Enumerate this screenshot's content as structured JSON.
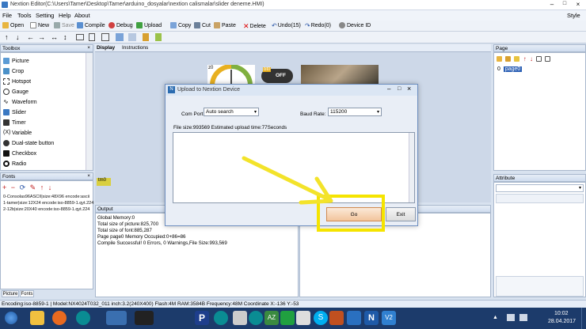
{
  "window": {
    "title": "Nextion Editor(C:\\Users\\Tamer\\Desktop\\Tamer\\arduino_dosyalar\\nextion calismalar\\slider deneme.HMI)"
  },
  "menu": {
    "items": [
      "File",
      "Tools",
      "Setting",
      "Help",
      "About"
    ],
    "style": "Style"
  },
  "toolbar": {
    "open": "Open",
    "new": "New",
    "save": "Save",
    "compile": "Compile",
    "debug": "Debug",
    "upload": "Upload",
    "copy": "Copy",
    "cut": "Cut",
    "paste": "Paste",
    "delete": "Delete",
    "undo": "Undo(15)",
    "redo": "Redo(0)",
    "device_id": "Device  ID"
  },
  "toolbox": {
    "title": "Toolbox",
    "items": [
      "Picture",
      "Crop",
      "Hotspot",
      "Gauge",
      "Waveform",
      "Slider",
      "Timer",
      "Variable",
      "Dual-state button",
      "Checkbox",
      "Radio"
    ]
  },
  "fonts": {
    "title": "Fonts",
    "items": [
      "0-Consolas96ASCII|size:48X96 encode:ascii",
      "1-tamer|size:12X24 encode:iso-8859-1.qyt.224",
      "2-12b|size:20X40 encode:iso-8859-1.qyt.224"
    ]
  },
  "bottom_tabs": {
    "picture": "Picture",
    "fonts": "Fonts"
  },
  "center_tabs": {
    "display": "Display",
    "instructions": "Instructions"
  },
  "canvas": {
    "gauge_label": "z0",
    "toggle_id": "bt0",
    "toggle_state": "OFF",
    "timer_badge": "tm0"
  },
  "page_panel": {
    "title": "Page",
    "item": "page0"
  },
  "attribute_panel": {
    "title": "Attribute"
  },
  "output": {
    "title": "Output",
    "lines": [
      "Global Memory:0",
      "Total size of picture:825,700",
      "Total size of font:885,287",
      "Page page0 Memory Occupied:0+86=86",
      "Compile Successful! 0 Errors, 0 Warnings,File Size:993,569"
    ]
  },
  "dialog": {
    "title": "Upload to Nextion Device",
    "com_port_label": "Com Port:",
    "com_port_value": "Auto search",
    "baud_label": "Baud Rate:",
    "baud_value": "115200",
    "file_info": "File size:993569 Estimated upload time:77Seconds",
    "go": "Go",
    "exit": "Exit"
  },
  "statusbar": {
    "text": "Encoding:iso-8859-1 | Model:NX4024T032_011  inch:3.2(240X400) Flash:4M RAM:3584B Frequency:48M     Coordinate X:-136  Y:-53"
  },
  "taskbar": {
    "time": "10:02",
    "date": "28.04.2017"
  },
  "colors": {
    "highlight_box": "#f5e400",
    "arrow": "#f3e32a",
    "taskbar": "#1c3b6b"
  }
}
